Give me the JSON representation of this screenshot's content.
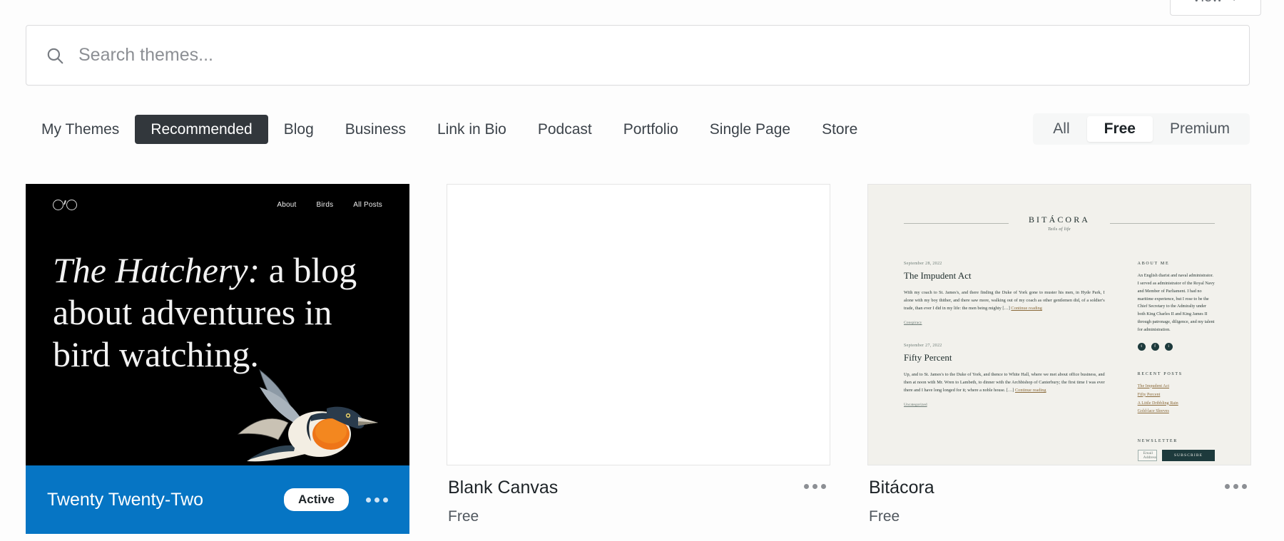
{
  "toolbar": {
    "view_label": "View",
    "view_caret": "caret-down-icon"
  },
  "search": {
    "placeholder": "Search themes...",
    "value": "",
    "icon": "search-icon"
  },
  "tabs": [
    {
      "label": "My Themes",
      "active": false
    },
    {
      "label": "Recommended",
      "active": true
    },
    {
      "label": "Blog",
      "active": false
    },
    {
      "label": "Business",
      "active": false
    },
    {
      "label": "Link in Bio",
      "active": false
    },
    {
      "label": "Podcast",
      "active": false
    },
    {
      "label": "Portfolio",
      "active": false
    },
    {
      "label": "Single Page",
      "active": false
    },
    {
      "label": "Store",
      "active": false
    }
  ],
  "price_filter": [
    {
      "label": "All",
      "active": false
    },
    {
      "label": "Free",
      "active": true
    },
    {
      "label": "Premium",
      "active": false
    }
  ],
  "themes": [
    {
      "name": "Twenty Twenty-Two",
      "price": "",
      "status": "Active",
      "menu_icon": "ellipsis-icon",
      "preview": {
        "nav": [
          "About",
          "Birds",
          "All Posts"
        ],
        "heading_italic": "The Hatchery:",
        "heading_rest": " a blog about adventures in bird watching."
      }
    },
    {
      "name": "Blank Canvas",
      "price": "Free",
      "status": "",
      "menu_icon": "ellipsis-icon",
      "preview": {}
    },
    {
      "name": "Bitácora",
      "price": "Free",
      "status": "",
      "menu_icon": "ellipsis-icon",
      "preview": {
        "brand": "BITÁCORA",
        "tagline": "Tails of life",
        "post1": {
          "date": "September 28, 2022",
          "title": "The Impudent Act",
          "body": "With my coach to St. James's, and there finding the Duke of York gone to muster his men, in Hyde Park, I alone with my boy thither, and there saw more, walking out of my coach as other gentlemen did, of a soldier's trade, than ever I did in my life: the men being mighty […] ",
          "more": "Continue reading",
          "category": "Conspiracy"
        },
        "post2": {
          "date": "September 27, 2022",
          "title": "Fifty Percent",
          "body": "Up, and to St. James's to the Duke of York, and thence to White Hall, where we met about office business, and then at noon with Mr. Wren to Lambeth, to dinner with the Archbishop of Canterbury; the first time I was ever there and I have long longed for it; where a noble house. […] ",
          "more": "Continue reading",
          "category": "Uncategorized"
        },
        "about_heading": "ABOUT ME",
        "about_body": "An English diarist and naval administrator. I served as administrator of the Royal Navy and Member of Parliament. I had no maritime experience, but I rose to be the Chief Secretary to the Admiralty under both King Charles II and King James II through patronage, diligence, and my talent for administration.",
        "socials": [
          "t",
          "f",
          "i"
        ],
        "recent_heading": "RECENT POSTS",
        "recent_posts": [
          "The Impudent Act",
          "Fifty Percent",
          "A Little Dribbling Rain",
          "Gold-lace Sleeves"
        ],
        "newsletter_heading": "NEWSLETTER",
        "newsletter_placeholder": "Email Address",
        "newsletter_button": "SUBSCRIBE"
      }
    }
  ],
  "colors": {
    "accent_blue": "#0675c4",
    "tab_active_bg": "#32373c",
    "page_bg": "#fdfdfd",
    "bitacora_bg": "#f2f1ec",
    "bitacora_ink": "#1c2b2a"
  }
}
